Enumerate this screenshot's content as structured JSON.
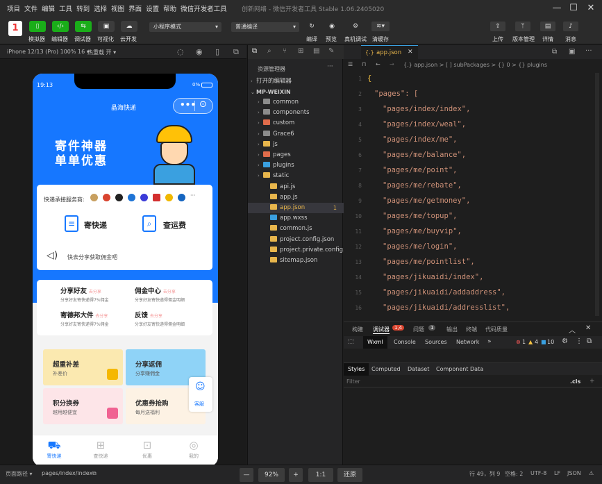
{
  "menu": [
    "项目",
    "文件",
    "编辑",
    "工具",
    "转到",
    "选择",
    "视图",
    "界面",
    "设置",
    "帮助",
    "微信开发者工具"
  ],
  "window_title": "创新网络 - 微信开发者工具 Stable 1.06.2405020",
  "toolbar": {
    "badge": "1",
    "buttons": [
      "模拟器",
      "编辑器",
      "调试器",
      "可视化",
      "云开发"
    ],
    "mode_select": "小程序模式",
    "compile_select": "普通编译",
    "actions": [
      "编译",
      "预览",
      "真机调试",
      "清缓存"
    ],
    "right_actions": [
      "上传",
      "版本管理",
      "详情",
      "消息"
    ]
  },
  "sim_bar": {
    "device": "iPhone 12/13 (Pro) 100% 16 ▾",
    "hot": "热重载 开 ▾"
  },
  "phone": {
    "time": "19:13",
    "battery": "0%",
    "nav_title": "晶海快递",
    "hero_line1": "寄件神器",
    "hero_line2": "单单优惠",
    "carriers_label": "快递承接服务商:",
    "carrier_more": "···",
    "send_label": "寄快递",
    "track_label": "查运费",
    "share_tip": "快去分享获取佣金吧",
    "features": [
      {
        "title": "分享好友",
        "tag": "去分享",
        "desc": "分享好友寄快递得7%佣金"
      },
      {
        "title": "佣金中心",
        "tag": "去分享",
        "desc": "分享好友寄快递得佣金明细"
      },
      {
        "title": "寄德邦大件",
        "tag": "去分享",
        "desc": "分享好友寄快递得7%佣金"
      },
      {
        "title": "反馈",
        "tag": "去分享",
        "desc": "分享好友寄快递得佣金明细"
      }
    ],
    "tiles": [
      {
        "title": "超重补差",
        "sub": "补差价"
      },
      {
        "title": "分享返佣",
        "sub": "分享赚佣金"
      },
      {
        "title": "积分换券",
        "sub": "越用越便宜"
      },
      {
        "title": "优惠券抢购",
        "sub": "每月送福利"
      }
    ],
    "service": "客服",
    "tabs": [
      "寄快递",
      "查快递",
      "优惠",
      "我的"
    ]
  },
  "explorer": {
    "header": "资源管理器",
    "open_editors": "打开的编辑器",
    "project": "MP-WEIXIN",
    "items": [
      {
        "name": "common",
        "type": "folder",
        "color": "#8c8c8c"
      },
      {
        "name": "components",
        "type": "folder",
        "color": "#8c8c8c"
      },
      {
        "name": "custom",
        "type": "folder",
        "color": "#e06c4b"
      },
      {
        "name": "Grace6",
        "type": "folder",
        "color": "#8c8c8c"
      },
      {
        "name": "js",
        "type": "folder",
        "color": "#e8b64c"
      },
      {
        "name": "pages",
        "type": "folder",
        "color": "#e06c4b"
      },
      {
        "name": "plugins",
        "type": "folder",
        "color": "#3aa0e0"
      },
      {
        "name": "static",
        "type": "folder",
        "color": "#e8b64c"
      },
      {
        "name": "api.js",
        "type": "file",
        "color": "#e8b64c"
      },
      {
        "name": "app.js",
        "type": "file",
        "color": "#e8b64c"
      },
      {
        "name": "app.json",
        "type": "file",
        "color": "#e8b64c"
      },
      {
        "name": "app.wxss",
        "type": "file",
        "color": "#3aa0e0"
      },
      {
        "name": "common.js",
        "type": "file",
        "color": "#e8b64c"
      },
      {
        "name": "project.config.json",
        "type": "file",
        "color": "#e8b64c"
      },
      {
        "name": "project.private.config.js...",
        "type": "file",
        "color": "#e8b64c"
      },
      {
        "name": "sitemap.json",
        "type": "file",
        "color": "#e8b64c"
      }
    ],
    "app_json_badge": "1"
  },
  "editor": {
    "tab": "app.json",
    "breadcrumb": "{.} app.json > [ ] subPackages > {} 0 > {} plugins",
    "lines": [
      "1",
      "2",
      "3",
      "4",
      "5",
      "6",
      "7",
      "8",
      "9",
      "10",
      "11",
      "12",
      "13",
      "14",
      "15",
      "16"
    ],
    "code": [
      "{",
      "\"pages\": [",
      "\"pages/index/index\",",
      "\"pages/index/weal\",",
      "\"pages/index/me\",",
      "\"pages/me/balance\",",
      "\"pages/me/point\",",
      "\"pages/me/rebate\",",
      "\"pages/me/getmoney\",",
      "\"pages/me/topup\",",
      "\"pages/me/buyvip\",",
      "\"pages/me/login\",",
      "\"pages/me/pointlist\",",
      "\"pages/jikuaidi/index\",",
      "\"pages/jikuaidi/addaddress\",",
      "\"pages/jikuaidi/addresslist\","
    ]
  },
  "panel": {
    "tabs": [
      "构建",
      "调试器",
      "问题",
      "输出",
      "终端",
      "代码质量"
    ],
    "debug_badge": "1,4",
    "problem_badge": "1",
    "devtools_tabs": [
      "Wxml",
      "Console",
      "Sources",
      "Network"
    ],
    "errors": "1",
    "warnings": "4",
    "infos": "10",
    "style_tabs": [
      "Styles",
      "Computed",
      "Dataset",
      "Component Data"
    ],
    "filter": "Filter",
    "cls": ".cls"
  },
  "status": {
    "path_label": "页面路径 ▾",
    "path": "pages/index/index",
    "zoom": "92%",
    "ratio": "1:1",
    "restore": "还原",
    "cursor": "行 49，列 9",
    "spaces": "空格: 2",
    "encoding": "UTF-8",
    "eol": "LF",
    "lang": "JSON"
  }
}
